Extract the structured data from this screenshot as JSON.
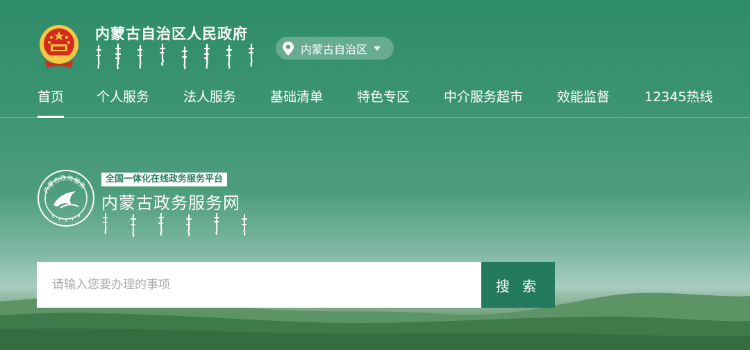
{
  "header": {
    "site_title": "内蒙古自治区人民政府",
    "region_select": {
      "label": "内蒙古自治区"
    }
  },
  "nav": {
    "items": [
      {
        "label": "首页",
        "active": true
      },
      {
        "label": "个人服务"
      },
      {
        "label": "法人服务"
      },
      {
        "label": "基础清单"
      },
      {
        "label": "特色专区"
      },
      {
        "label": "中介服务超市"
      },
      {
        "label": "效能监督"
      },
      {
        "label": "12345热线"
      }
    ]
  },
  "brand": {
    "tagline": "全国一体化在线政务服务平台",
    "name": "内蒙古政务服务网",
    "seal_text": "内蒙古政务服务"
  },
  "search": {
    "placeholder": "请输入您要办理的事项",
    "value": "",
    "button_label": "搜 索"
  },
  "colors": {
    "primary_green": "#2f8c69",
    "button_green": "#247a5c",
    "emblem_red": "#d52b1e",
    "emblem_gold": "#f6c945"
  }
}
